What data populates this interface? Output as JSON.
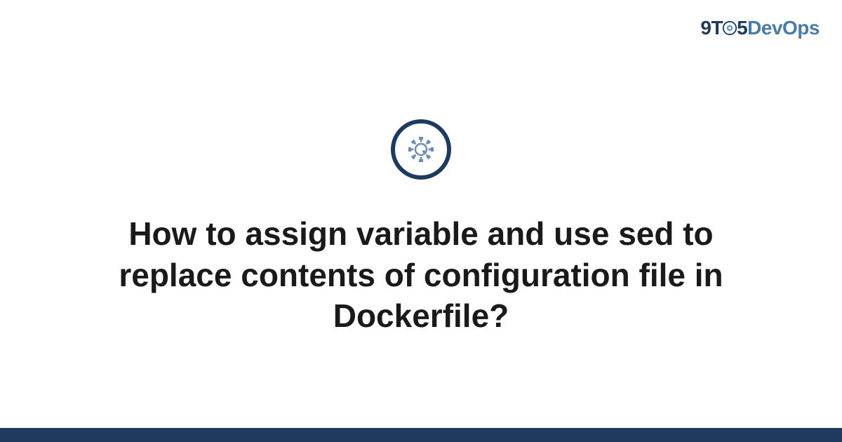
{
  "logo": {
    "nine": "9",
    "t": "T",
    "five": "5",
    "dev": "Dev",
    "ops": "Ops"
  },
  "title": "How to assign variable and use sed to replace contents of configuration file in Dockerfile?",
  "colors": {
    "dark_blue": "#1e3a5f",
    "light_blue": "#4a7ba6",
    "gear_stroke": "#6b8db3"
  }
}
